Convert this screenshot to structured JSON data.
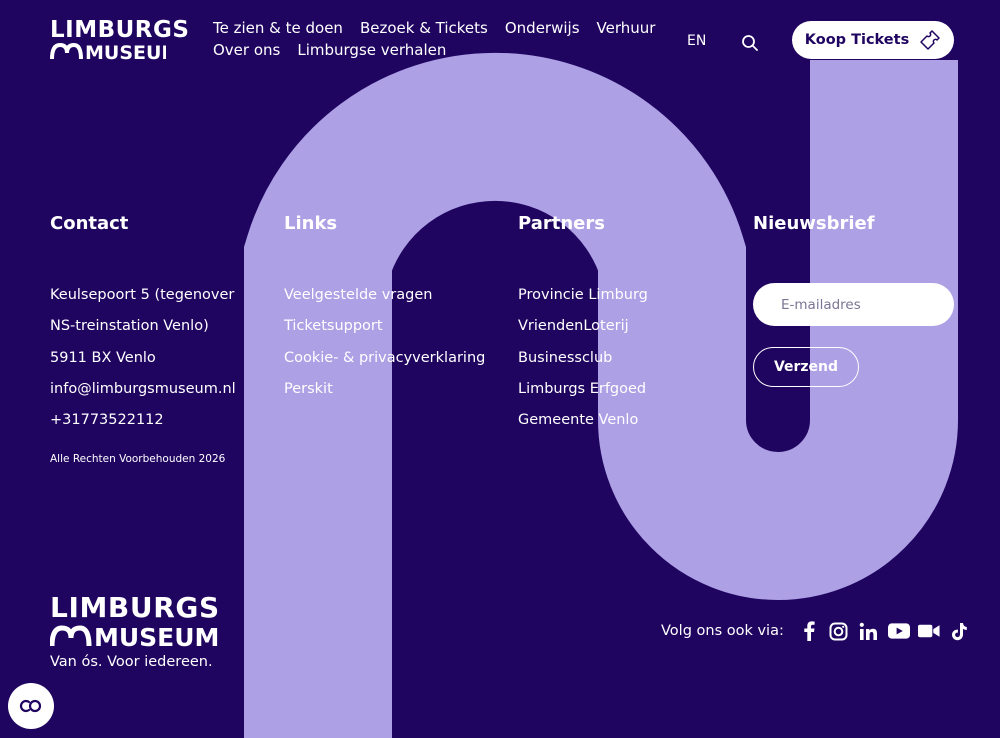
{
  "header": {
    "logo_text": "LIMBURGS",
    "logo_text_2": "MUSEUM",
    "nav": [
      [
        "Te zien & te doen",
        "Bezoek & Tickets",
        "Onderwijs",
        "Verhuur"
      ],
      [
        "Over ons",
        "Limburgse verhalen"
      ]
    ],
    "lang": "EN",
    "search_icon": "search-icon",
    "tickets_label": "Koop Tickets",
    "tickets_icon": "ticket-icon"
  },
  "footer": {
    "contact": {
      "heading": "Contact",
      "lines": [
        "Keulsepoort 5 (tegenover",
        "NS-treinstation Venlo)",
        "5911 BX Venlo",
        "info@limburgsmuseum.nl",
        "+31773522112"
      ],
      "rights": "Alle Rechten Voorbehouden 2026"
    },
    "links": {
      "heading": "Links",
      "items": [
        "Veelgestelde vragen",
        "Ticketsupport",
        "Cookie- & privacyverklaring",
        "Perskit"
      ]
    },
    "partners": {
      "heading": "Partners",
      "items": [
        "Provincie Limburg",
        "VriendenLoterij",
        "Businessclub",
        "Limburgs Erfgoed",
        "Gemeente Venlo"
      ]
    },
    "newsletter": {
      "heading": "Nieuwsbrief",
      "placeholder": "E-mailadres",
      "submit_label": "Verzend"
    },
    "tagline": "Van ós. Voor iedereen.",
    "social_label": "Volg ons ook via:",
    "social_icons": [
      "facebook-icon",
      "instagram-icon",
      "linkedin-icon",
      "youtube-icon",
      "video-icon",
      "tiktok-icon"
    ],
    "cookie_button_icon": "cookie-settings-icon"
  },
  "colors": {
    "background": "#1f0560",
    "shape": "#ada0e5",
    "text": "#ffffff"
  }
}
